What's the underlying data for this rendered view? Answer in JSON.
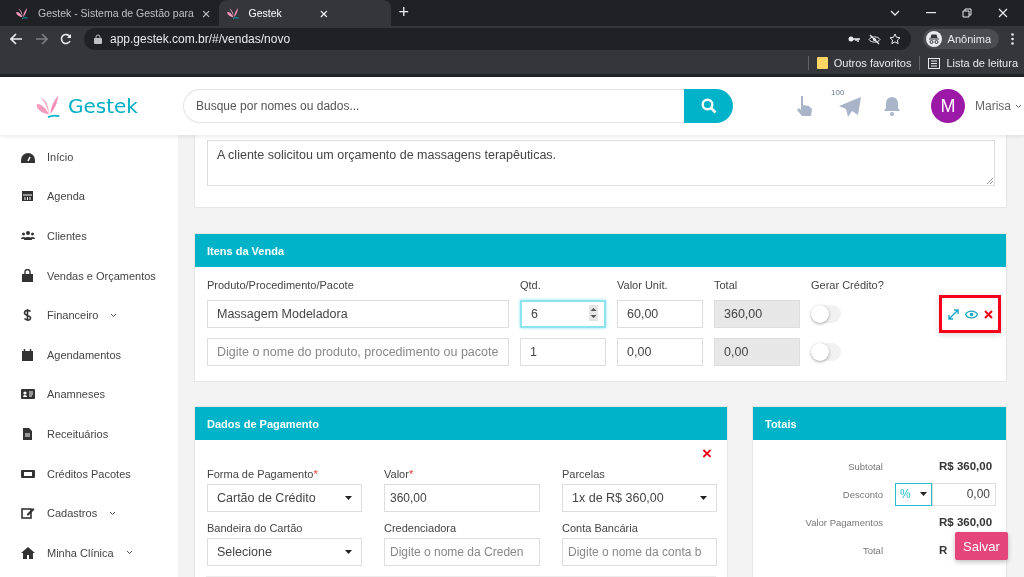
{
  "browser": {
    "tabs": [
      {
        "title": "Gestek - Sistema de Gestão para",
        "close": "×",
        "selected": false
      },
      {
        "title": "Gestek",
        "close": "×",
        "selected": true
      }
    ],
    "new_tab": "+",
    "url": "app.gestek.com.br/#/vendas/novo",
    "profile": "Anônima",
    "bookmarks": [
      "Outros favoritos",
      "Lista de leitura"
    ]
  },
  "header": {
    "logo": "Gestek",
    "search": {
      "placeholder": "Busque por nomes ou dados..."
    },
    "messages_badge": "100",
    "user": {
      "initial": "M",
      "name": "Marisa"
    }
  },
  "sidebar": {
    "items": [
      {
        "label": "Início",
        "expandable": false
      },
      {
        "label": "Agenda",
        "expandable": false
      },
      {
        "label": "Clientes",
        "expandable": false
      },
      {
        "label": "Vendas e Orçamentos",
        "expandable": false
      },
      {
        "label": "Financeiro",
        "expandable": true
      },
      {
        "label": "Agendamentos",
        "expandable": false
      },
      {
        "label": "Anamneses",
        "expandable": false
      },
      {
        "label": "Receituários",
        "expandable": false
      },
      {
        "label": "Créditos Pacotes",
        "expandable": false
      },
      {
        "label": "Cadastros",
        "expandable": true
      },
      {
        "label": "Minha Clínica",
        "expandable": true
      }
    ]
  },
  "observations": {
    "value": "A cliente solicitou um orçamento de massagens terapêuticas."
  },
  "items": {
    "title": "Itens da Venda",
    "columns": [
      "Produto/Procedimento/Pacote",
      "Qtd.",
      "Valor Unit.",
      "Total",
      "Gerar Crédito?"
    ],
    "rows": [
      {
        "product": "Massagem Modeladora",
        "qty": "6",
        "unit_price": "60,00",
        "total": "360,00",
        "credit": false,
        "focused": true,
        "actions_shown": true
      },
      {
        "product_placeholder": "Digite o nome do produto, procedimento ou pacote",
        "qty": "1",
        "unit_price": "0,00",
        "total": "0,00",
        "credit": false,
        "focused": false,
        "actions_shown": false
      }
    ]
  },
  "payment": {
    "title": "Dados de Pagamento",
    "remove": "×",
    "fields": [
      {
        "label": "Forma de Pagamento",
        "required_mark": "*",
        "kind": "select",
        "value": "Cartão de Crédito"
      },
      {
        "label": "Valor",
        "required_mark": "*",
        "kind": "input",
        "value": "360,00"
      },
      {
        "label": "Parcelas",
        "kind": "select",
        "value": "1x de R$ 360,00"
      },
      {
        "label": "Bandeira do Cartão",
        "kind": "select",
        "value": "Selecione"
      },
      {
        "label": "Credenciadora",
        "kind": "input",
        "placeholder": "Digite o nome da Creden"
      },
      {
        "label": "Conta Bancária",
        "kind": "input",
        "placeholder": "Digite o nome da conta b"
      }
    ]
  },
  "totals": {
    "title": "Totais",
    "rows": [
      {
        "kind": "value",
        "label": "Subtotal",
        "value": "R$ 360,00"
      },
      {
        "kind": "discount",
        "label": "Desconto",
        "unit": "%",
        "value": "0,00"
      },
      {
        "kind": "value",
        "label": "Valor Pagamentos",
        "value": "R$ 360,00"
      },
      {
        "kind": "value",
        "label": "Total",
        "value": "R"
      }
    ]
  },
  "save_button": "Salvar"
}
